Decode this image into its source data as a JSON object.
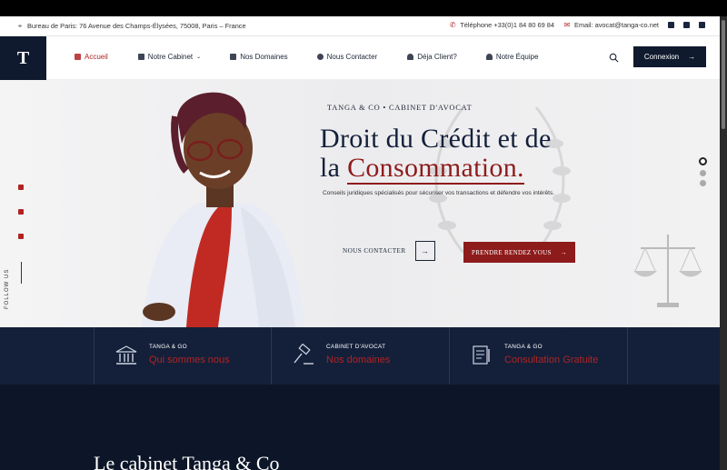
{
  "topbar": {
    "address": "Bureau de Paris: 76 Avenue des Champs-Élysées, 75008, Paris – France",
    "phone": "Téléphone +33(0)1 84 80 69 84",
    "email": "Email: avocat@tanga-co.net",
    "socials": [
      "facebook-icon",
      "youtube-icon",
      "linkedin-icon"
    ]
  },
  "nav": {
    "logo": "T",
    "items": [
      {
        "label": "Accueil",
        "icon": "home-icon",
        "active": true
      },
      {
        "label": "Notre Cabinet",
        "icon": "building-icon",
        "dropdown": true
      },
      {
        "label": "Nos Domaines",
        "icon": "book-icon"
      },
      {
        "label": "Nous Contacter",
        "icon": "phone-icon"
      },
      {
        "label": "Déja Client?",
        "icon": "user-icon"
      },
      {
        "label": "Notre Équipe",
        "icon": "team-icon"
      }
    ],
    "connect_label": "Connexion"
  },
  "hero": {
    "eyebrow": "TANGA & CO • CABINET D'AVOCAT",
    "title_line1": "Droit du Crédit et de",
    "title_line2_prefix": "la ",
    "title_line2_accent": "Consommation.",
    "subtitle": "Conseils juridiques spécialisés pour sécuriser vos transactions et défendre vos intérêts.",
    "contact_label": "NOUS CONTACTER",
    "rdv_label": "PRENDRE RENDEZ VOUS",
    "follow_label": "FOLLOW US",
    "active_slide": 1,
    "slide_count": 3
  },
  "features": [
    {
      "kicker": "TANGA & GO",
      "title": "Qui sommes nous",
      "icon": "courthouse-icon"
    },
    {
      "kicker": "CABINET D'AVOCAT",
      "title": "Nos domaines",
      "icon": "gavel-icon"
    },
    {
      "kicker": "TANGA & GO",
      "title": "Consultation Gratuite",
      "icon": "document-icon"
    }
  ],
  "section": {
    "heading": "Le cabinet Tanga & Co"
  },
  "colors": {
    "navy": "#14203a",
    "accent": "#8e1b1b"
  }
}
